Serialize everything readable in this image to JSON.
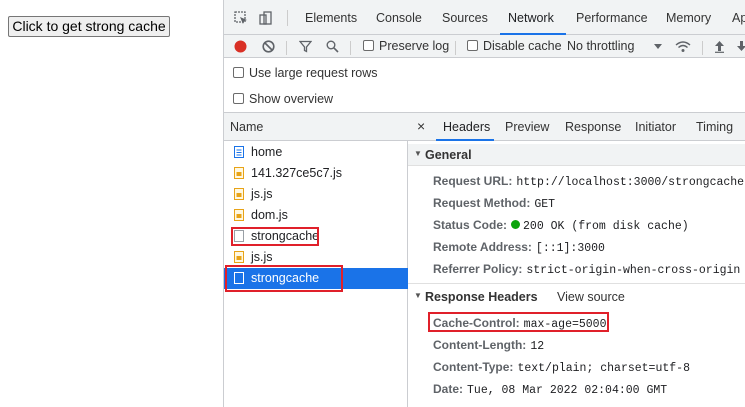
{
  "page": {
    "button_label": "Click to get strong cache"
  },
  "devtools": {
    "tabs": [
      "Elements",
      "Console",
      "Sources",
      "Network",
      "Performance",
      "Memory",
      "Ap"
    ],
    "active_tab": "Network",
    "toolbar": {
      "preserve_log": "Preserve log",
      "disable_cache": "Disable cache",
      "throttling": "No throttling"
    },
    "options": {
      "large_rows": "Use large request rows",
      "show_overview": "Show overview"
    },
    "name_header": "Name",
    "requests": [
      {
        "name": "home",
        "type": "doc"
      },
      {
        "name": "141.327ce5c7.js",
        "type": "script"
      },
      {
        "name": "js.js",
        "type": "script"
      },
      {
        "name": "dom.js",
        "type": "script"
      },
      {
        "name": "strongcache",
        "type": "plain"
      },
      {
        "name": "js.js",
        "type": "script"
      },
      {
        "name": "strongcache",
        "type": "plain",
        "selected": true
      }
    ],
    "detail_tabs": [
      "Headers",
      "Preview",
      "Response",
      "Initiator",
      "Timing"
    ],
    "close_glyph": "×",
    "general": {
      "title": "General",
      "request_url_label": "Request URL:",
      "request_url": "http://localhost:3000/strongcache",
      "method_label": "Request Method:",
      "method": "GET",
      "status_label": "Status Code:",
      "status": "200 OK (from disk cache)",
      "remote_label": "Remote Address:",
      "remote": "[::1]:3000",
      "referrer_label": "Referrer Policy:",
      "referrer": "strict-origin-when-cross-origin"
    },
    "response_headers": {
      "title": "Response Headers",
      "view_source": "View source",
      "cache_control_label": "Cache-Control:",
      "cache_control": "max-age=5000",
      "content_length_label": "Content-Length:",
      "content_length": "12",
      "content_type_label": "Content-Type:",
      "content_type": "text/plain; charset=utf-8",
      "date_label": "Date:",
      "date": "Tue, 08 Mar 2022 02:04:00 GMT"
    }
  },
  "colors": {
    "accent": "#1a73e8",
    "record": "#d93025",
    "highlight": "#e0202a",
    "status_ok": "#0ca40c"
  }
}
